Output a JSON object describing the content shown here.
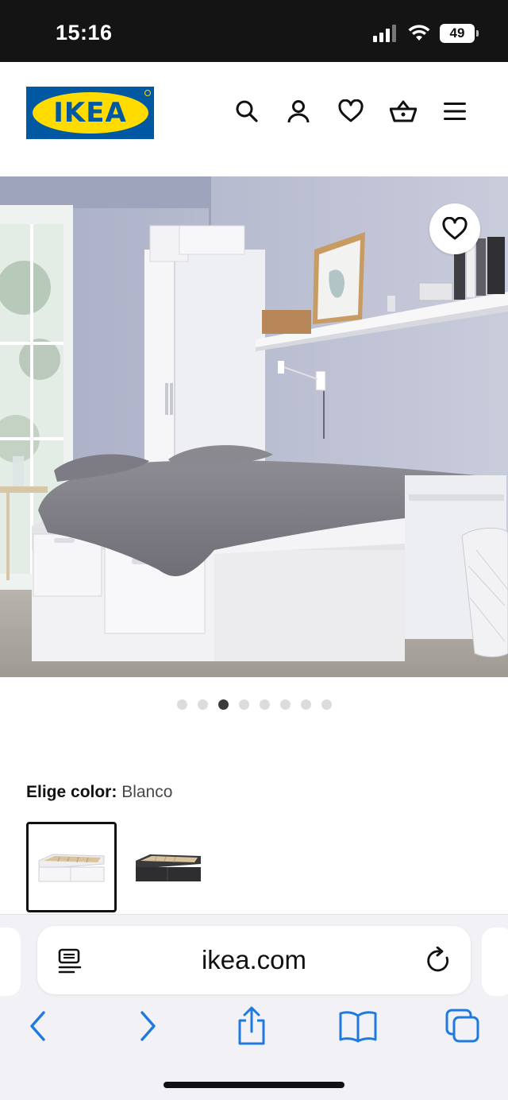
{
  "status": {
    "time": "15:16",
    "battery": "49"
  },
  "header": {
    "logo_text": "IKEA",
    "icons": [
      "search-icon",
      "user-icon",
      "heart-icon",
      "basket-icon",
      "menu-icon"
    ],
    "brand_blue": "#0058a3",
    "brand_yellow": "#ffdb00"
  },
  "gallery": {
    "total_images": 8,
    "active_index": 2,
    "favorite_icon": "heart-icon"
  },
  "color_picker": {
    "label": "Elige color:",
    "selected_value": "Blanco",
    "swatches": [
      {
        "name": "Blanco",
        "selected": true
      },
      {
        "name": "Negro",
        "selected": false
      }
    ]
  },
  "browser": {
    "url": "ikea.com",
    "icons": [
      "reader-icon",
      "reload-icon",
      "back-icon",
      "forward-icon",
      "share-icon",
      "bookmarks-icon",
      "tabs-icon"
    ],
    "accent": "#1f7ae0"
  }
}
